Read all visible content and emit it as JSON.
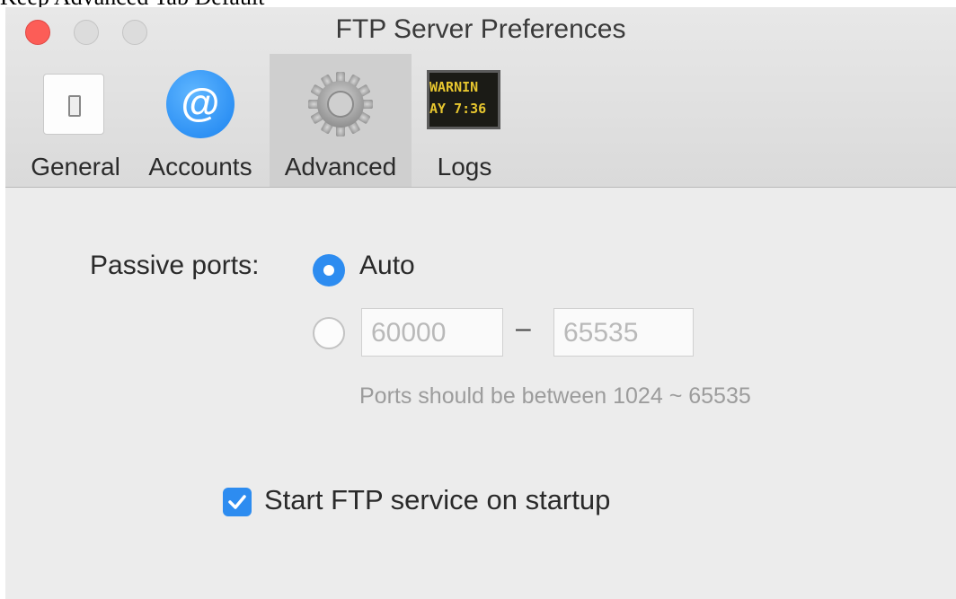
{
  "caption": "Keep Advanced Tab Default",
  "window": {
    "title": "FTP Server Preferences"
  },
  "toolbar": {
    "tabs": [
      {
        "label": "General",
        "icon": "toggle-switch-icon"
      },
      {
        "label": "Accounts",
        "icon": "at-sign-icon",
        "glyph": "@"
      },
      {
        "label": "Advanced",
        "icon": "gear-icon",
        "selected": true
      },
      {
        "label": "Logs",
        "icon": "log-console-icon",
        "screen_lines": [
          "WARNIN",
          "AY 7:36"
        ]
      }
    ]
  },
  "advanced": {
    "passive_ports_label": "Passive ports:",
    "auto_option_label": "Auto",
    "auto_selected": true,
    "range_start": "60000",
    "range_separator": "–",
    "range_end": "65535",
    "hint": "Ports should be between 1024 ~ 65535",
    "startup_label": "Start FTP service on startup",
    "startup_checked": true
  },
  "colors": {
    "accent": "#2d8cf0",
    "close": "#fc5d57"
  }
}
